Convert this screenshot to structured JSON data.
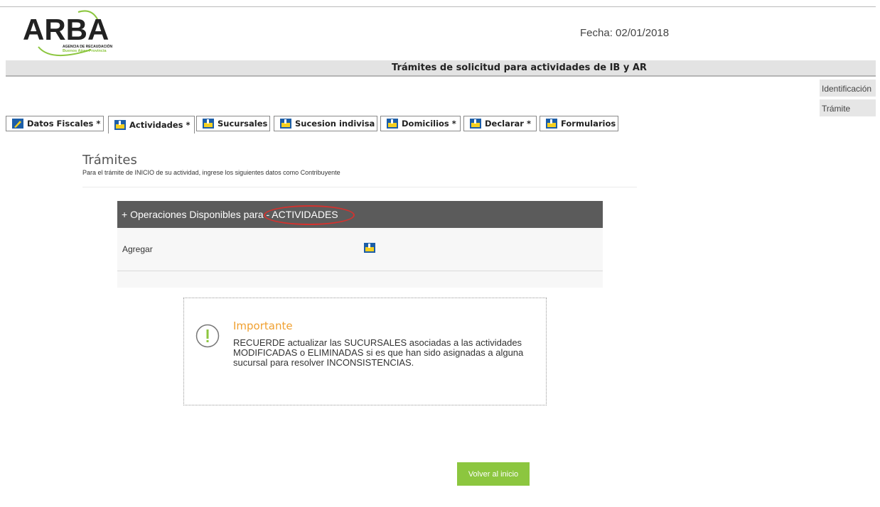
{
  "header": {
    "logo_text": "ARBA",
    "logo_sub1": "AGENCIA DE RECAUDACIÓN",
    "logo_sub2": "Buenos Aires Provincia",
    "fecha": "Fecha: 02/01/2018",
    "page_title": "Trámites de solicitud para actividades de IB y AR"
  },
  "side_links": [
    "Identificación",
    "Trámite"
  ],
  "tabs": [
    {
      "label": "Datos Fiscales *",
      "active": false
    },
    {
      "label": "Actividades *",
      "active": true
    },
    {
      "label": "Sucursales",
      "active": false
    },
    {
      "label": "Sucesion indivisa",
      "active": false
    },
    {
      "label": "Domicilios *",
      "active": false
    },
    {
      "label": "Declarar *",
      "active": false
    },
    {
      "label": "Formularios",
      "active": false
    }
  ],
  "section": {
    "title": "Trámites",
    "subtitle": "Para el trámite de INICIO de su actividad, ingrese los siguientes datos como Contribuyente"
  },
  "operations": {
    "header": "+ Operaciones Disponibles para - ACTIVIDADES",
    "rows": [
      {
        "label": "Agregar",
        "icon": "add-icon"
      }
    ]
  },
  "notice": {
    "title": "Importante",
    "body": "RECUERDE actualizar las SUCURSALES asociadas a las actividades MODIFICADAS o ELIMINADAS si es que han sido asignadas a alguna sucursal para resolver INCONSISTENCIAS."
  },
  "buttons": {
    "volver": "Volver al inicio"
  },
  "colors": {
    "brand_green": "#8cc63f",
    "ops_header_bg": "#5b5b5b",
    "notice_title": "#f0a030",
    "highlight_red": "#d4322e",
    "tab_icon_blue": "#1c5ea8",
    "tab_icon_yellow": "#f5d020"
  }
}
